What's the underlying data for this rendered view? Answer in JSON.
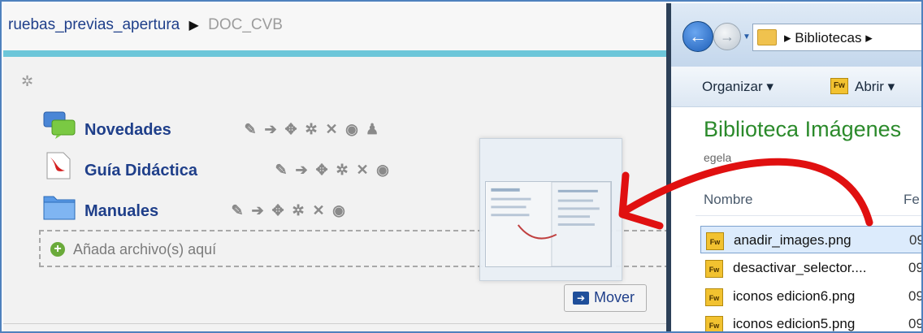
{
  "breadcrumb": {
    "parent": "ruebas_previas_apertura",
    "separator": "▶",
    "current": "DOC_CVB"
  },
  "resources": [
    {
      "label": "Novedades",
      "icon": "forum-icon",
      "actions": [
        "✎",
        "➔",
        "✥",
        "✲",
        "✕",
        "◉",
        "♟"
      ]
    },
    {
      "label": "Guía Didáctica",
      "icon": "pdf-icon",
      "actions": [
        "✎",
        "➔",
        "✥",
        "✲",
        "✕",
        "◉"
      ]
    },
    {
      "label": "Manuales",
      "icon": "folder-icon",
      "actions": [
        "✎",
        "➔",
        "✥",
        "✲",
        "✕",
        "◉"
      ]
    }
  ],
  "dropzone": {
    "text": "Añada archivo(s) aquí",
    "icon": "+"
  },
  "move_button": {
    "label": "Mover",
    "icon": "➔"
  },
  "explorer": {
    "path": "Bibliotecas",
    "toolbar": {
      "organize": "Organizar ▾",
      "open": "Abrir ▾",
      "fw_badge": "Fw"
    },
    "library_title": "Biblioteca Imágenes",
    "library_subtitle": "egela",
    "columns": {
      "name": "Nombre",
      "date": "Fe"
    },
    "files": [
      {
        "name": "anadir_images.png",
        "date": "09",
        "selected": true
      },
      {
        "name": "desactivar_selector....",
        "date": "09",
        "selected": false
      },
      {
        "name": "iconos edicion6.png",
        "date": "09",
        "selected": false
      },
      {
        "name": "iconos edicion5.png",
        "date": "09",
        "selected": false
      }
    ]
  },
  "colors": {
    "link": "#1f3f8a",
    "accent_line": "#6cc6d9",
    "arrow": "#e01010",
    "title_green": "#2b8a2b"
  }
}
